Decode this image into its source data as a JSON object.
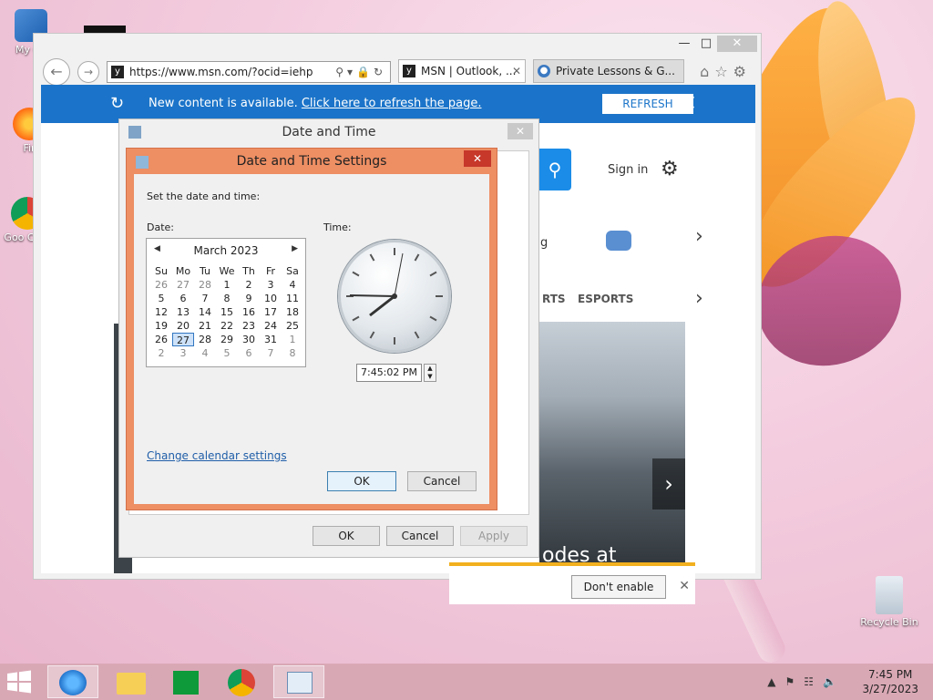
{
  "desktop": {
    "icons": [
      {
        "label": "My Co"
      },
      {
        "label": "Fir"
      },
      {
        "label": "Goo Chro"
      },
      {
        "label": "Recycle Bin"
      }
    ]
  },
  "ie": {
    "address": "https://www.msn.com/?ocid=iehp",
    "tabs": [
      {
        "label": "MSN | Outlook, ..."
      },
      {
        "label": "Private Lessons & G..."
      }
    ],
    "notify": {
      "message": "New content is available.",
      "link": "Click here to refresh the page.",
      "refresh_label": "REFRESH"
    },
    "page": {
      "sign_in": "Sign in",
      "nav_sports": "RTS",
      "nav_esports": "ESPORTS",
      "news_title": "odes at",
      "weather_partial": "g"
    },
    "popup": {
      "dont_enable": "Don't enable"
    }
  },
  "date_time_dialog": {
    "title": "Date and Time",
    "ok": "OK",
    "cancel": "Cancel",
    "apply": "Apply"
  },
  "settings_dialog": {
    "title": "Date and Time Settings",
    "intro": "Set the date and time:",
    "date_label": "Date:",
    "time_label": "Time:",
    "month": "March 2023",
    "weekdays": [
      "Su",
      "Mo",
      "Tu",
      "We",
      "Th",
      "Fr",
      "Sa"
    ],
    "weeks": [
      [
        "26",
        "27",
        "28",
        "1",
        "2",
        "3",
        "4"
      ],
      [
        "5",
        "6",
        "7",
        "8",
        "9",
        "10",
        "11"
      ],
      [
        "12",
        "13",
        "14",
        "15",
        "16",
        "17",
        "18"
      ],
      [
        "19",
        "20",
        "21",
        "22",
        "23",
        "24",
        "25"
      ],
      [
        "26",
        "27",
        "28",
        "29",
        "30",
        "31",
        "1"
      ],
      [
        "2",
        "3",
        "4",
        "5",
        "6",
        "7",
        "8"
      ]
    ],
    "time_value": "7:45:02 PM",
    "change_calendar": "Change calendar settings",
    "ok": "OK",
    "cancel": "Cancel"
  },
  "taskbar": {
    "time": "7:45 PM",
    "date": "3/27/2023"
  },
  "colors": {
    "accent_blue": "#1b74c9",
    "dialog_orange": "#ed8e63",
    "close_red": "#c7372a",
    "taskbar": "#d9a8b5"
  }
}
